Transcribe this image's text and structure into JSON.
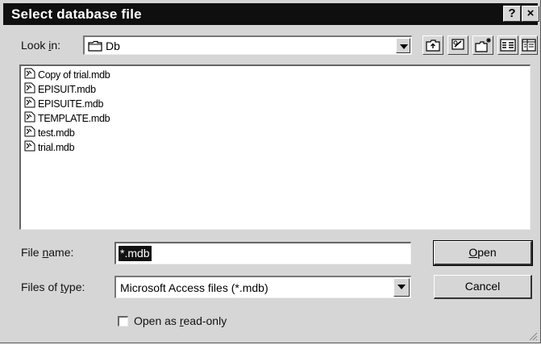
{
  "window": {
    "title": "Select database file",
    "help_label": "?",
    "close_label": "×"
  },
  "look_in": {
    "label_prefix": "Look ",
    "label_underlined": "i",
    "label_suffix": "n:",
    "value": "Db",
    "icon": "folder-icon"
  },
  "toolbar": {
    "buttons": [
      {
        "icon": "up-one-level-icon"
      },
      {
        "icon": "desktop-icon"
      },
      {
        "icon": "new-folder-icon"
      },
      {
        "icon": "list-view-icon"
      },
      {
        "icon": "details-view-icon"
      }
    ]
  },
  "files": [
    {
      "name": "Copy of trial.mdb",
      "icon": "access-file-icon"
    },
    {
      "name": "EPISUIT.mdb",
      "icon": "access-file-icon"
    },
    {
      "name": "EPISUITE.mdb",
      "icon": "access-file-icon"
    },
    {
      "name": "TEMPLATE.mdb",
      "icon": "access-file-icon"
    },
    {
      "name": "test.mdb",
      "icon": "access-file-icon"
    },
    {
      "name": "trial.mdb",
      "icon": "access-file-icon"
    }
  ],
  "file_name": {
    "label_prefix": "File ",
    "label_underlined": "n",
    "label_suffix": "ame:",
    "value": "*.mdb"
  },
  "file_type": {
    "label_prefix": "Files of ",
    "label_underlined": "t",
    "label_suffix": "ype:",
    "value": "Microsoft Access files (*.mdb)"
  },
  "buttons": {
    "open_underlined": "O",
    "open_rest": "pen",
    "cancel": "Cancel"
  },
  "read_only": {
    "label_prefix": "Open as ",
    "label_underlined": "r",
    "label_suffix": "ead-only",
    "checked": false
  },
  "colors": {
    "dialog_bg": "#d6d6d6",
    "titlebar_bg": "#0f0f0f",
    "selection_bg": "#111111"
  }
}
